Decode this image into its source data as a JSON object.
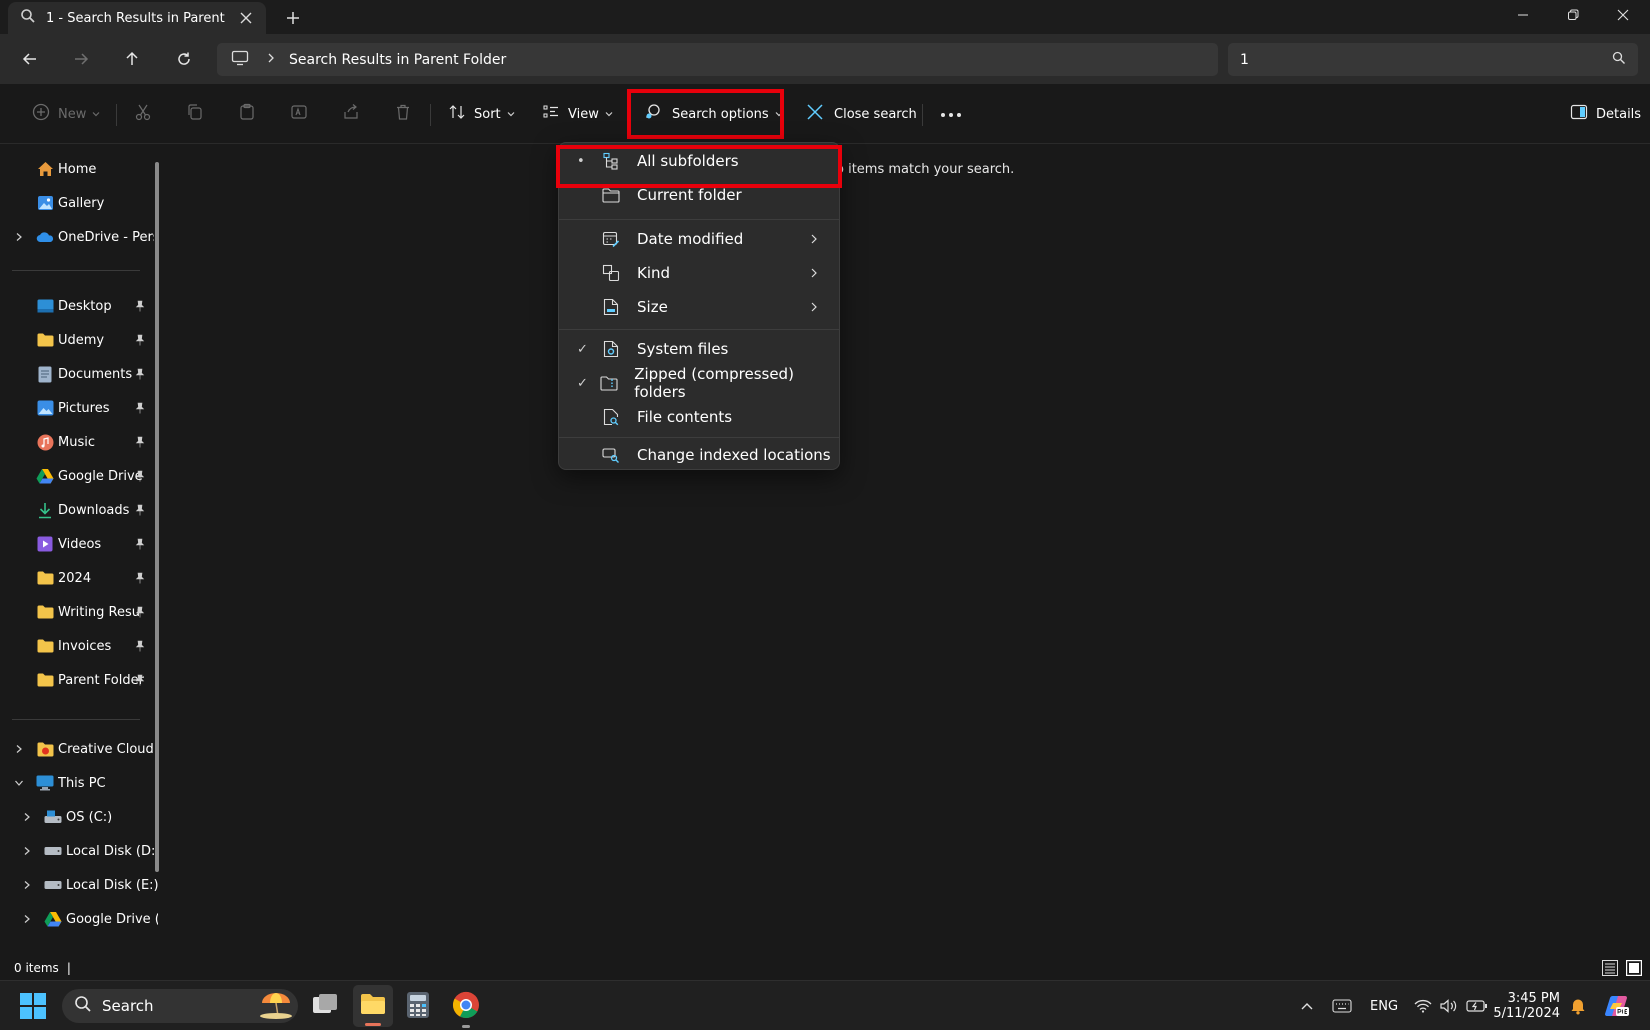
{
  "tab": {
    "title": "1 - Search Results in Parent Fol"
  },
  "address": {
    "breadcrumb": "Search Results in Parent Folder"
  },
  "search": {
    "value": "1"
  },
  "toolbar": {
    "new_label": "New",
    "sort_label": "Sort",
    "view_label": "View",
    "search_options_label": "Search options",
    "close_search_label": "Close search",
    "details_label": "Details"
  },
  "sidebar": {
    "items": [
      {
        "label": "Home"
      },
      {
        "label": "Gallery"
      },
      {
        "label": "OneDrive - Persc"
      },
      {
        "label": "Desktop"
      },
      {
        "label": "Udemy"
      },
      {
        "label": "Documents"
      },
      {
        "label": "Pictures"
      },
      {
        "label": "Music"
      },
      {
        "label": "Google Drive"
      },
      {
        "label": "Downloads"
      },
      {
        "label": "Videos"
      },
      {
        "label": "2024"
      },
      {
        "label": "Writing Resu"
      },
      {
        "label": "Invoices"
      },
      {
        "label": "Parent Folder"
      },
      {
        "label": "Creative Cloud F"
      },
      {
        "label": "This PC"
      },
      {
        "label": "OS (C:)"
      },
      {
        "label": "Local Disk (D:)"
      },
      {
        "label": "Local Disk (E:)"
      },
      {
        "label": "Google Drive ("
      }
    ]
  },
  "main": {
    "empty_message": "o items match your search."
  },
  "search_menu": {
    "items": [
      {
        "label": "All subfolders",
        "mark": "•"
      },
      {
        "label": "Current folder",
        "mark": ""
      },
      {
        "label": "Date modified",
        "mark": ""
      },
      {
        "label": "Kind",
        "mark": ""
      },
      {
        "label": "Size",
        "mark": ""
      },
      {
        "label": "System files",
        "mark": "✓"
      },
      {
        "label": "Zipped (compressed) folders",
        "mark": "✓"
      },
      {
        "label": "File contents",
        "mark": ""
      },
      {
        "label": "Change indexed locations",
        "mark": ""
      }
    ]
  },
  "status": {
    "item_count": "0 items",
    "cursor": "|"
  },
  "taskbar": {
    "search_label": "Search",
    "language": "ENG",
    "time": "3:45 PM",
    "date": "5/11/2024"
  },
  "colors": {
    "accent": "#60cdff",
    "highlight_box": "#e8000b",
    "folder": "#f3c44a"
  }
}
